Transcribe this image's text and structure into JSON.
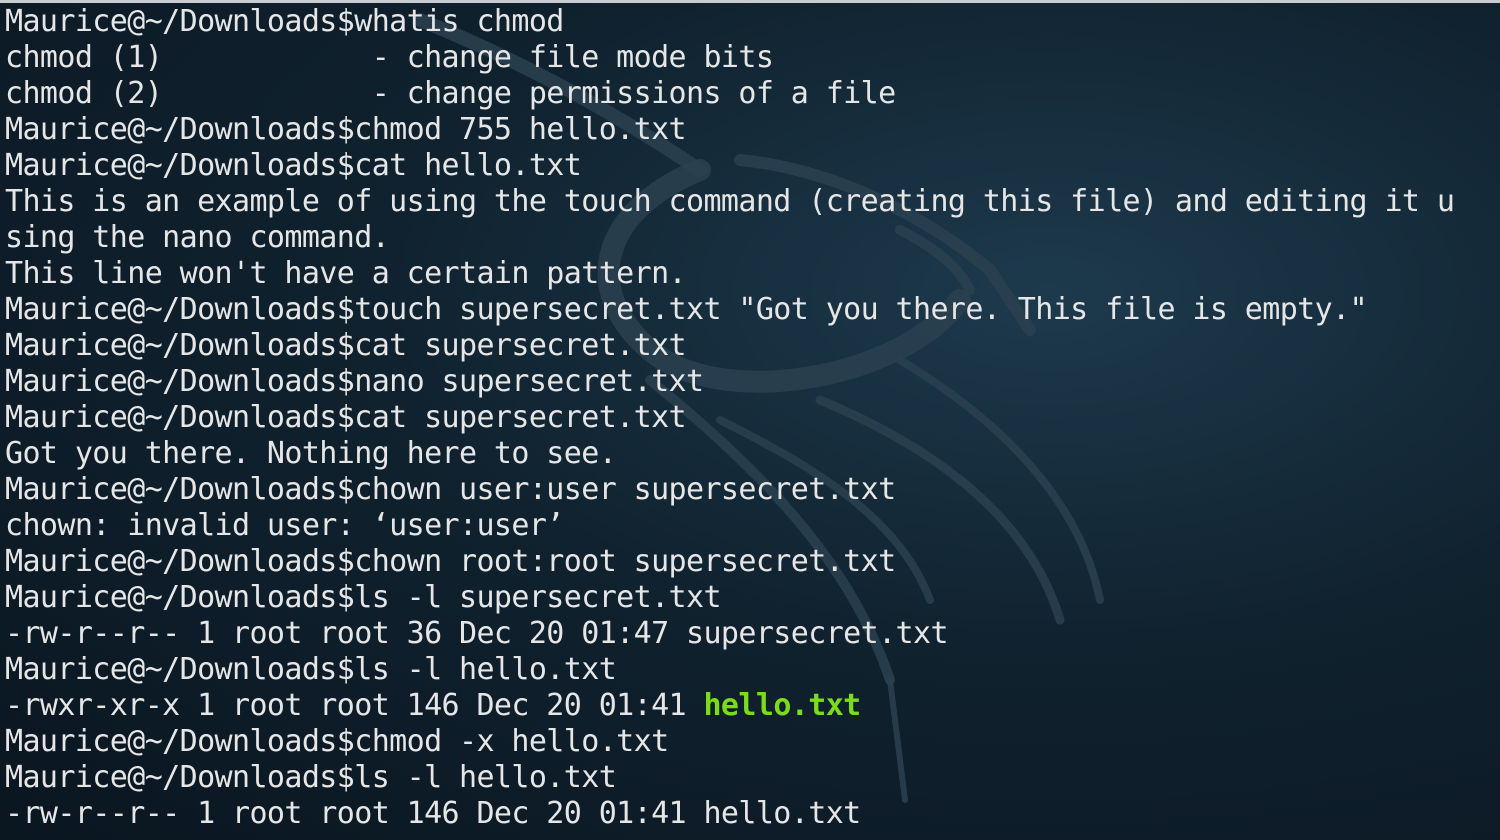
{
  "terminal": {
    "lines": [
      "Maurice@~/Downloads$whatis chmod",
      "chmod (1)            - change file mode bits",
      "chmod (2)            - change permissions of a file",
      "Maurice@~/Downloads$chmod 755 hello.txt",
      "Maurice@~/Downloads$cat hello.txt",
      "This is an example of using the touch command (creating this file) and editing it u",
      "sing the nano command.",
      "This line won't have a certain pattern.",
      "Maurice@~/Downloads$touch supersecret.txt \"Got you there. This file is empty.\"",
      "Maurice@~/Downloads$cat supersecret.txt",
      "Maurice@~/Downloads$nano supersecret.txt",
      "Maurice@~/Downloads$cat supersecret.txt",
      "Got you there. Nothing here to see.",
      "Maurice@~/Downloads$chown user:user supersecret.txt",
      "chown: invalid user: ‘user:user’",
      "Maurice@~/Downloads$chown root:root supersecret.txt",
      "Maurice@~/Downloads$ls -l supersecret.txt",
      "-rw-r--r-- 1 root root 36 Dec 20 01:47 supersecret.txt",
      "Maurice@~/Downloads$ls -l hello.txt"
    ],
    "exec_line_prefix": "-rwxr-xr-x 1 root root 146 Dec 20 01:41 ",
    "exec_line_file": "hello.txt",
    "lines_after": [
      "Maurice@~/Downloads$chmod -x hello.txt",
      "Maurice@~/Downloads$ls -l hello.txt",
      "-rw-r--r-- 1 root root 146 Dec 20 01:41 hello.txt"
    ],
    "colors": {
      "text": "#e6e6e6",
      "executable_file": "#7bdc1c",
      "background": "#10222f"
    }
  }
}
